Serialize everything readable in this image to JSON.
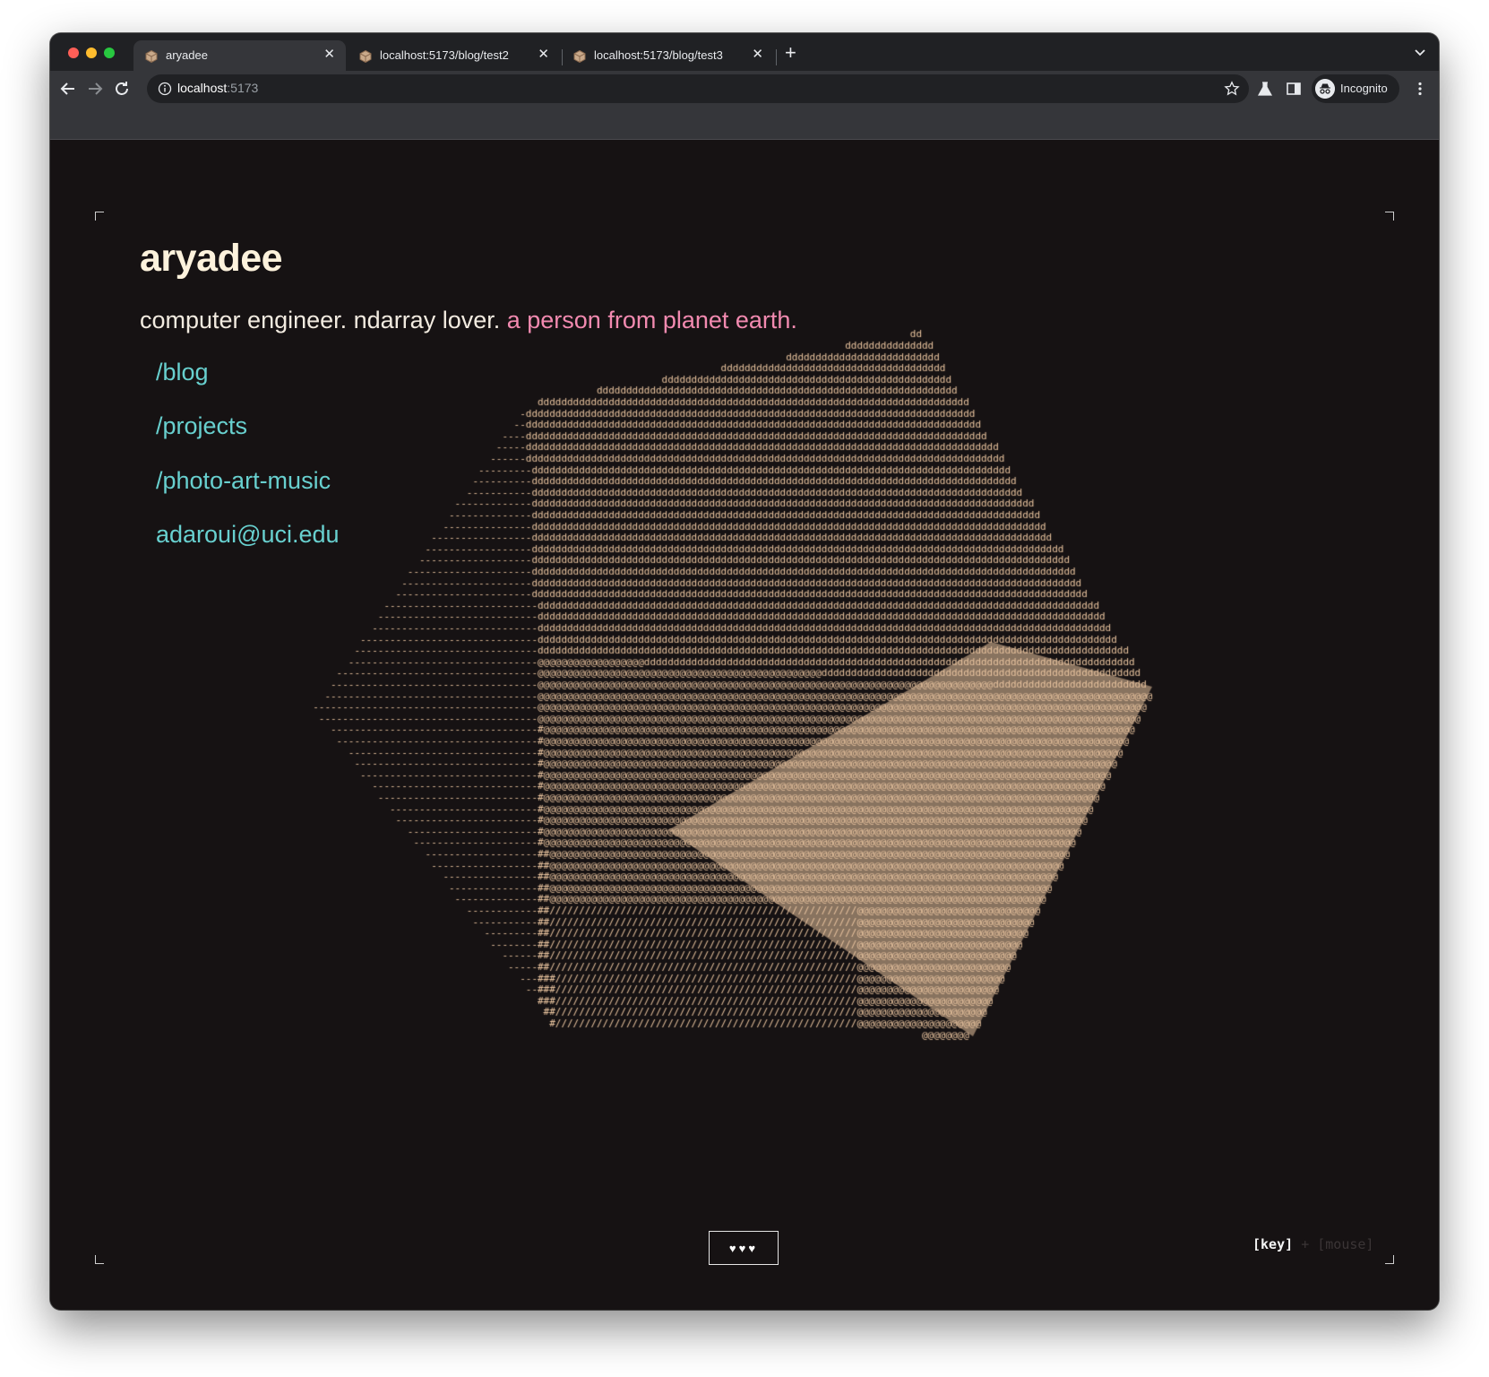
{
  "browser": {
    "tabs": [
      {
        "title": "aryadee",
        "active": true
      },
      {
        "title": "localhost:5173/blog/test2",
        "active": false
      },
      {
        "title": "localhost:5173/blog/test3",
        "active": false
      }
    ],
    "url_host": "localhost",
    "url_port": ":5173",
    "profile_label": "Incognito"
  },
  "site": {
    "title": "aryadee",
    "tagline_plain": "computer engineer. ndarray lover.",
    "tagline_accent": "a person from planet earth.",
    "nav": [
      "/blog",
      "/projects",
      "/photo-art-music",
      "adaroui@uci.edu"
    ]
  },
  "controls": {
    "hearts": "♥♥♥",
    "mode_key": "[key]",
    "mode_sep": "+",
    "mode_mouse": "[mouse]"
  },
  "art": {
    "type": "ascii-cube",
    "glyph_color": "#e8c39e",
    "glyphs": {
      "top": "d",
      "left": "#",
      "right": "@",
      "bottom": "/",
      "edge": "-"
    }
  },
  "colors": {
    "background": "#161213",
    "title": "#fdf2dc",
    "accent_pink": "#f28ab0",
    "link_cyan": "#68d0cf"
  }
}
